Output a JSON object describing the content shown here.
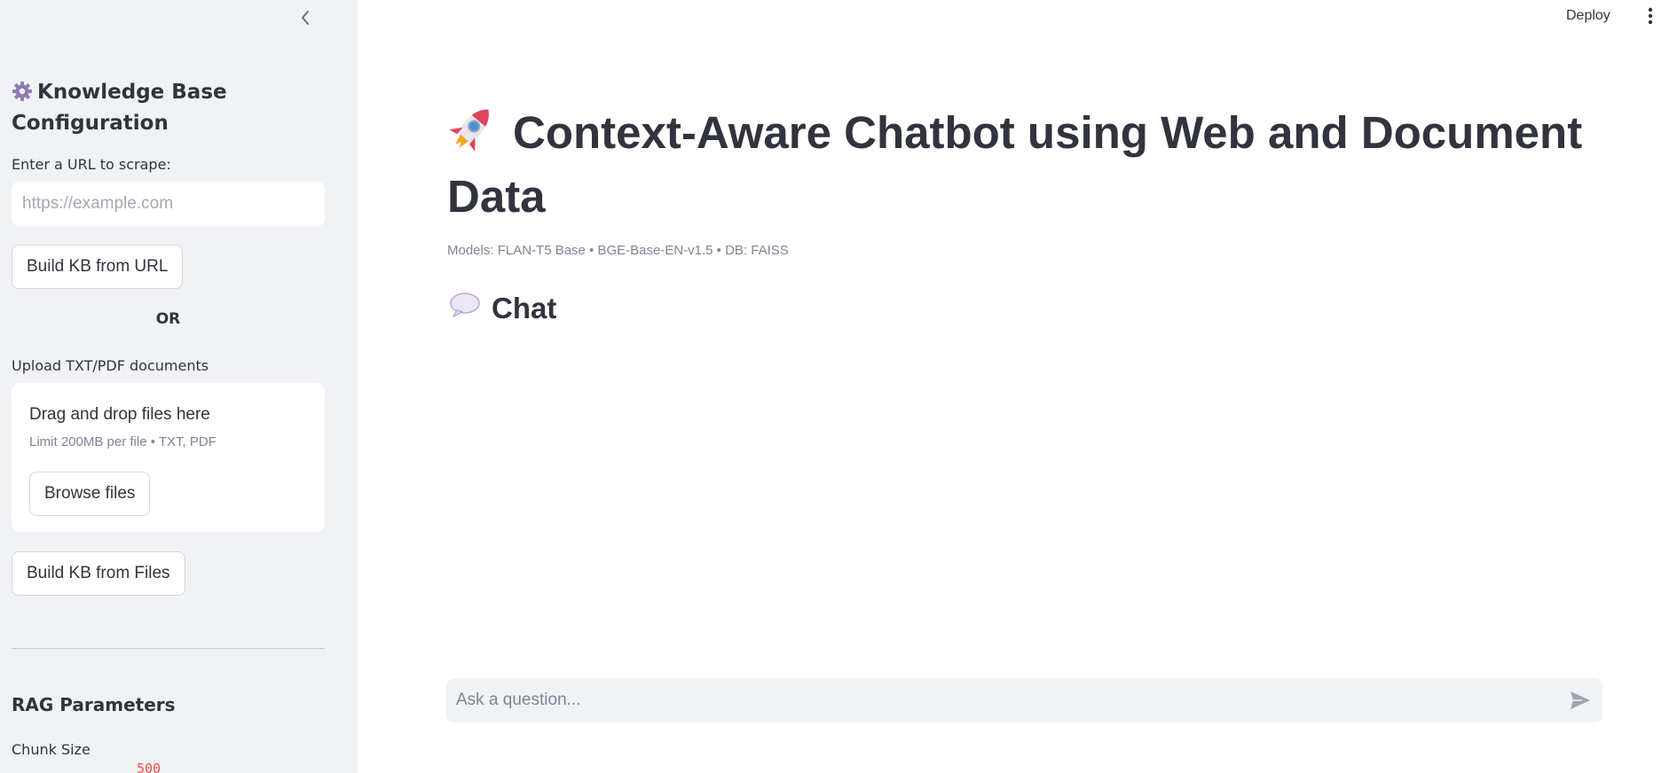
{
  "sidebar": {
    "title": "Knowledge Base Configuration",
    "url_label": "Enter a URL to scrape:",
    "url_placeholder": "https://example.com",
    "url_value": "",
    "build_url_button": "Build KB from URL",
    "or_text": "OR",
    "upload_label": "Upload TXT/PDF documents",
    "dropzone_title": "Drag and drop files here",
    "dropzone_limit": "Limit 200MB per file • TXT, PDF",
    "browse_button": "Browse files",
    "build_files_button": "Build KB from Files",
    "rag_title": "RAG Parameters",
    "chunk_size_label": "Chunk Size",
    "chunk_size_value": "500"
  },
  "header": {
    "deploy_label": "Deploy"
  },
  "main": {
    "title": "Context-Aware Chatbot using Web and Document Data",
    "caption": "Models: FLAN-T5 Base • BGE-Base-EN-v1.5 • DB: FAISS",
    "chat_heading": "Chat",
    "chat_placeholder": "Ask a question...",
    "chat_value": ""
  },
  "icons": {
    "collapse": "chevron-left-icon",
    "gear": "gear-icon",
    "menu": "more-vertical-icon",
    "rocket": "rocket-icon",
    "chat": "speech-bubble-icon",
    "send": "send-icon"
  },
  "colors": {
    "sidebar_bg": "#f0f2f6",
    "text": "#31333f",
    "muted": "#808495",
    "accent": "#ff4b4b"
  }
}
